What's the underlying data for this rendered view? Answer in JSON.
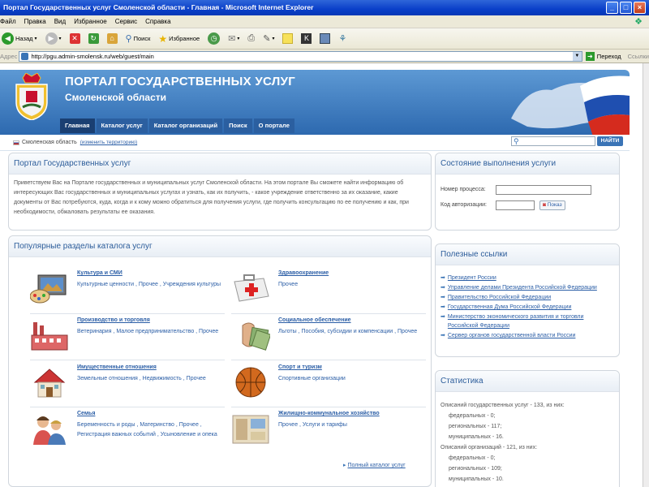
{
  "window": {
    "title": "Портал Государственных услуг Смоленской области - Главная - Microsoft Internet Explorer",
    "menu": [
      "Файл",
      "Правка",
      "Вид",
      "Избранное",
      "Сервис",
      "Справка"
    ],
    "toolbar": {
      "back": "Назад",
      "search": "Поиск",
      "favorites": "Избранное"
    },
    "address_label": "Адрес",
    "url": "http://pgu.admin-smolensk.ru/web/guest/main",
    "go_label": "Переход",
    "links_label": "Ссылки"
  },
  "header": {
    "title1": "ПОРТАЛ ГОСУДАРСТВЕННЫХ УСЛУГ",
    "title2": "Смоленской области",
    "nav": [
      "Главная",
      "Каталог услуг",
      "Каталог организаций",
      "Поиск",
      "О портале"
    ],
    "region": "Смоленская область",
    "change_region": "(изменить территорию)",
    "search_button": "НАЙТИ"
  },
  "intro": {
    "title": "Портал Государственных услуг",
    "text": "Приветствуем Вас на Портале государственных и муниципальных услуг Смоленской области. На этом портале Вы сможете найти информацию об интересующих Вас государственных и муниципальных услугах и узнать, как их получить, - какое учреждение ответственно за их оказание, какие документы от Вас потребуются, куда, когда и к кому можно обратиться для получения услуги, где получить консультацию по ее получению и как, при необходимости, обжаловать результаты ее оказания."
  },
  "status": {
    "title": "Состояние выполнения услуги",
    "process_label": "Номер процесса:",
    "auth_label": "Код авторизации:",
    "show_button": "Показ"
  },
  "catalog": {
    "title": "Популярные разделы каталога услуг",
    "items": [
      {
        "title": "Культура и СМИ",
        "links": "Культурные ценности , Прочее , Учреждения культуры"
      },
      {
        "title": "Здравоохранение",
        "links": "Прочее"
      },
      {
        "title": "Производство и торговля",
        "links": "Ветеринария , Малое предпринимательство , Прочее"
      },
      {
        "title": "Социальное обеспечение",
        "links": "Льготы , Пособия, субсидии и компенсации , Прочее"
      },
      {
        "title": "Имущественные отношения",
        "links": "Земельные отношения , Недвижимость , Прочее"
      },
      {
        "title": "Спорт и туризм",
        "links": "Спортивные организации"
      },
      {
        "title": "Семья",
        "links": "Беременность и роды , Материнство , Прочее , Регистрация важных событий , Усыновление и опека"
      },
      {
        "title": "Жилищно-коммунальное хозяйство",
        "links": "Прочее , Услуги и тарифы"
      }
    ],
    "full_link": "Полный каталог услуг"
  },
  "links": {
    "title": "Полезные ссылки",
    "items": [
      "Президент России",
      "Управление делами Президента Российской Федерации",
      "Правительство Российской Федерации",
      "Государственная Дума Российской Федерации",
      "Министерство экономического развития и торговли Российской Федерации",
      "Сервер органов государственной власти России"
    ]
  },
  "stats": {
    "title": "Статистика",
    "lines": [
      "Описаний государственных услуг - 133, из них:",
      "федеральных - 0;",
      "региональных - 117;",
      "муниципальных - 16.",
      "Описаний организаций - 121, из них:",
      "федеральных - 0;",
      "региональных - 109;",
      "муниципальных - 10."
    ]
  },
  "colors": {
    "accent": "#2b5ea6",
    "header_blue": "#2a66ad",
    "ie_title": "#0a3fc9"
  }
}
